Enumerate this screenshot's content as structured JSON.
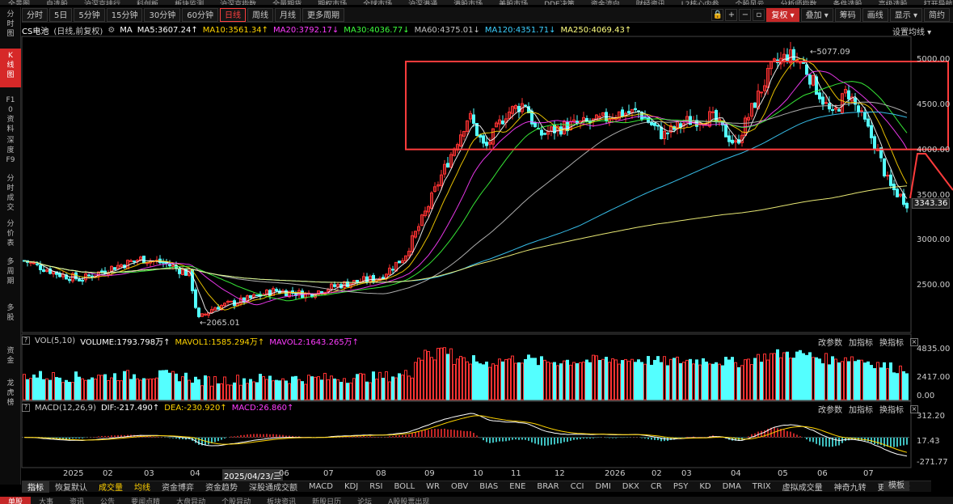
{
  "topnav": [
    "全景图",
    "自选股",
    "沪深京排行",
    "科创板",
    "板块监测",
    "沪深京指数",
    "全量期货",
    "期权市场",
    "全球市场",
    "沪深港通",
    "港股市场",
    "美股市场",
    "DDE决策",
    "资金流向",
    "财经资讯",
    "L2核心内参",
    "个股风云",
    "分析师指数",
    "条件选股",
    "高级选股",
    "打开导航",
    "返回"
  ],
  "toolbar": {
    "items": [
      "分时",
      "5日",
      "5分钟",
      "15分钟",
      "30分钟",
      "60分钟",
      "日线",
      "周线",
      "月线",
      "更多周期"
    ],
    "active": "日线",
    "right": {
      "fuquan": "复权",
      "overlay": "叠加",
      "chip": "筹码",
      "frame": "画线",
      "display": "显示",
      "simple": "简约"
    }
  },
  "lefttabs": [
    {
      "label": "分时图",
      "top": 9,
      "h": 30
    },
    {
      "label": "K线图",
      "top": 60,
      "h": 48,
      "active": true
    },
    {
      "label": "F10资料",
      "top": 115,
      "h": 42
    },
    {
      "label": "深度F9",
      "top": 165,
      "h": 42
    },
    {
      "label": "分时成交",
      "top": 212,
      "h": 52
    },
    {
      "label": "分价表",
      "top": 268,
      "h": 42
    },
    {
      "label": "多周期",
      "top": 315,
      "h": 42
    },
    {
      "label": "多股",
      "top": 372,
      "h": 30
    },
    {
      "label": "资金",
      "top": 425,
      "h": 30
    },
    {
      "label": "龙虎榜",
      "top": 465,
      "h": 42
    }
  ],
  "info": {
    "name": "CS电池",
    "mode": "(日线,前复权)",
    "ma": [
      {
        "text": "MA",
        "color": "#ffffff"
      },
      {
        "text": "MA5:3607.24↑",
        "color": "#ffffff"
      },
      {
        "text": "MA10:3561.34↑",
        "color": "#ffd400"
      },
      {
        "text": "MA20:3792.17↓",
        "color": "#ff3cff"
      },
      {
        "text": "MA30:4036.77↓",
        "color": "#3cff3c"
      },
      {
        "text": "MA60:4375.01↓",
        "color": "#c0c0c0"
      },
      {
        "text": "MA120:4351.71↓",
        "color": "#3ccfff"
      },
      {
        "text": "MA250:4069.43↑",
        "color": "#ffff80"
      }
    ],
    "setting": "设置均线"
  },
  "price_axis": {
    "labels": [
      "5000.00",
      "4500.00",
      "4000.00",
      "3500.00",
      "3000.00",
      "2500.00"
    ],
    "current": "3343.36",
    "high_label": "5077.09",
    "low_label": "2065.01"
  },
  "volume": {
    "title": "VOL(5,10)",
    "items": [
      {
        "text": "VOLUME:1793.798万↑",
        "color": "#ffffff"
      },
      {
        "text": "MAVOL1:1585.294万↑",
        "color": "#ffd400"
      },
      {
        "text": "MAVOL2:1643.265万↑",
        "color": "#ff3cff"
      }
    ],
    "axis": [
      "4835.00",
      "2417.00",
      "0.00"
    ]
  },
  "macd": {
    "title": "MACD(12,26,9)",
    "items": [
      {
        "text": "DIF:-217.490↑",
        "color": "#ffffff"
      },
      {
        "text": "DEA:-230.920↑",
        "color": "#ffd400"
      },
      {
        "text": "MACD:26.860↑",
        "color": "#ff3cff"
      }
    ],
    "axis": [
      "312.20",
      "17.43",
      "-271.77"
    ]
  },
  "sub_controls": {
    "params": "改参数",
    "add": "加指标",
    "switch": "换指标"
  },
  "xaxis": {
    "labels": [
      "2025",
      "02",
      "03",
      "04",
      "2025/04/23/三",
      "06",
      "07",
      "08",
      "09",
      "10",
      "11",
      "12",
      "2026",
      "02",
      "03",
      "04",
      "05",
      "06",
      "07"
    ]
  },
  "indicators": {
    "items": [
      "指标",
      "恢复默认",
      "成交量",
      "均线",
      "资金博弈",
      "资金趋势",
      "深股通成交额",
      "MACD",
      "KDJ",
      "RSI",
      "BOLL",
      "WR",
      "OBV",
      "BIAS",
      "ENE",
      "BRAR",
      "CCI",
      "DMI",
      "DKX",
      "CR",
      "PSY",
      "KD",
      "DMA",
      "TRIX",
      "虚拟成交量",
      "神奇九转",
      "更多指标"
    ],
    "active": "指标",
    "highlight": [
      "成交量",
      "均线"
    ],
    "template": "模板"
  },
  "bottom": [
    "单股",
    "大事",
    "资讯",
    "公告",
    "要闻点睛",
    "大盘异动",
    "个股异动",
    "板块资讯",
    "新股日历",
    "论坛",
    "A股股票出现"
  ],
  "colors": {
    "up": "#ff3232",
    "down": "#54ffff",
    "box": "#ff3c3c",
    "frame": "#444444"
  },
  "chart_data": {
    "type": "candlestick",
    "ylim": [
      2000,
      5150
    ],
    "high": 5077.09,
    "low": 2065.01,
    "last": 3343.36,
    "ma_last": {
      "MA5": 3607.24,
      "MA10": 3561.34,
      "MA20": 3792.17,
      "MA30": 4036.77,
      "MA60": 4375.01,
      "MA120": 4351.71,
      "MA250": 4069.43
    },
    "volume": {
      "ylim": [
        0,
        4835
      ],
      "last_wan": 1793.798
    },
    "macd": {
      "ylim": [
        -271.77,
        312.2
      ],
      "dif": -217.49,
      "dea": -230.92,
      "macd": 26.86
    },
    "annotation_box": {
      "from_price": 3950,
      "to_price": 4890
    }
  }
}
